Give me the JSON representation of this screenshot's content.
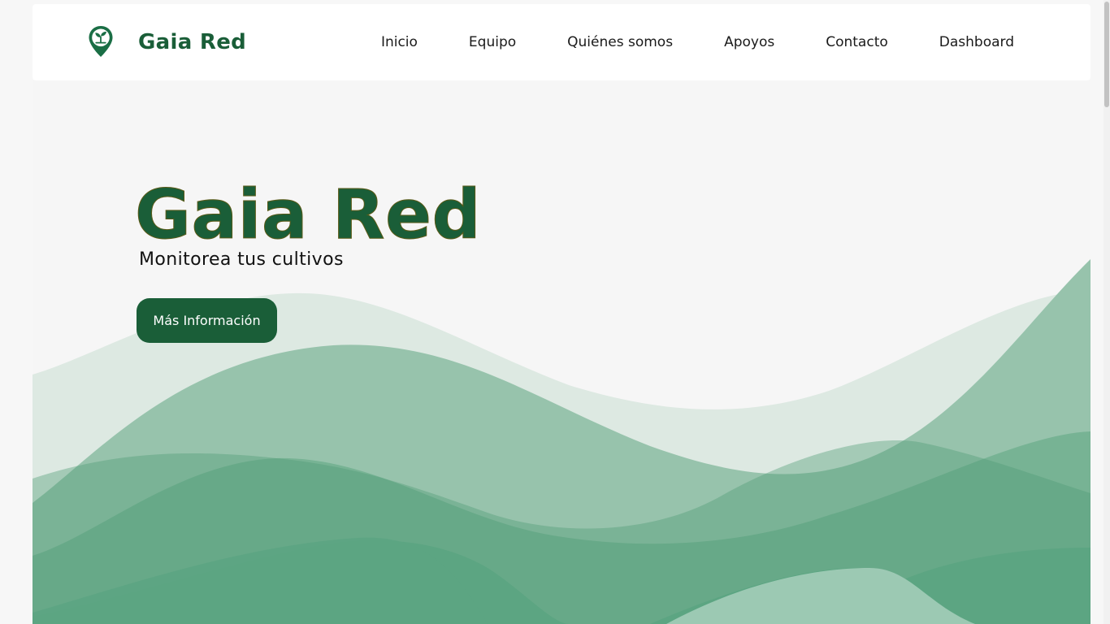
{
  "brand": {
    "name": "Gaia Red",
    "logo_icon": "plant-location-pin-icon"
  },
  "nav": {
    "items": [
      {
        "label": "Inicio"
      },
      {
        "label": "Equipo"
      },
      {
        "label": "Quiénes somos"
      },
      {
        "label": "Apoyos"
      },
      {
        "label": "Contacto"
      },
      {
        "label": "Dashboard"
      }
    ]
  },
  "hero": {
    "title": "Gaia Red",
    "subtitle": "Monitorea tus cultivos",
    "button_label": "Más Información"
  },
  "colors": {
    "brand_green": "#1a5e38",
    "page_background": "#f6f6f6",
    "navbar_background": "#ffffff",
    "wave_light": "#dde9e2",
    "wave_mid": "#97c3ac",
    "wave_dark": "#5ca582"
  },
  "scrollbar": {
    "position_fraction": 0.0
  }
}
